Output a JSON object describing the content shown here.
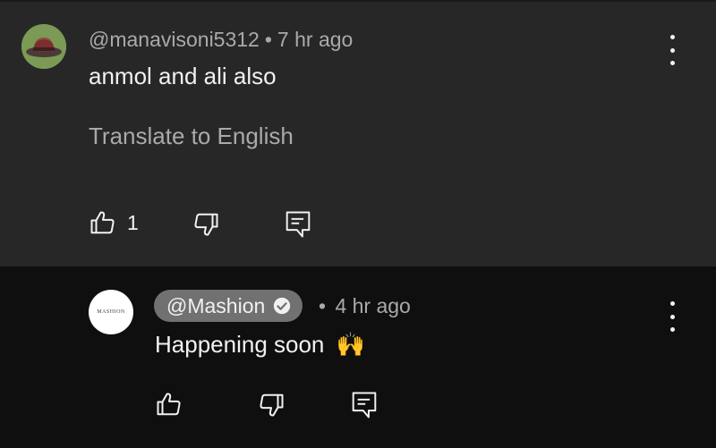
{
  "comment": {
    "author": "@manavisoni5312",
    "separator": "•",
    "time": "7 hr ago",
    "text": "anmol and ali also",
    "translate_label": "Translate to English",
    "like_count": "1"
  },
  "reply": {
    "author": "@Mashion",
    "separator": "•",
    "time": "4 hr ago",
    "text": "Happening soon",
    "emoji": "🙌",
    "avatar_text": "MASHION"
  },
  "icons": {
    "like": "thumbs-up-icon",
    "dislike": "thumbs-down-icon",
    "reply": "reply-icon",
    "menu": "more-vert-icon",
    "verified": "verified-check-icon"
  },
  "colors": {
    "comment_bg": "#272727",
    "reply_bg": "#0f0f0f",
    "secondary_text": "#aaaaaa",
    "chip_bg": "#717171"
  }
}
